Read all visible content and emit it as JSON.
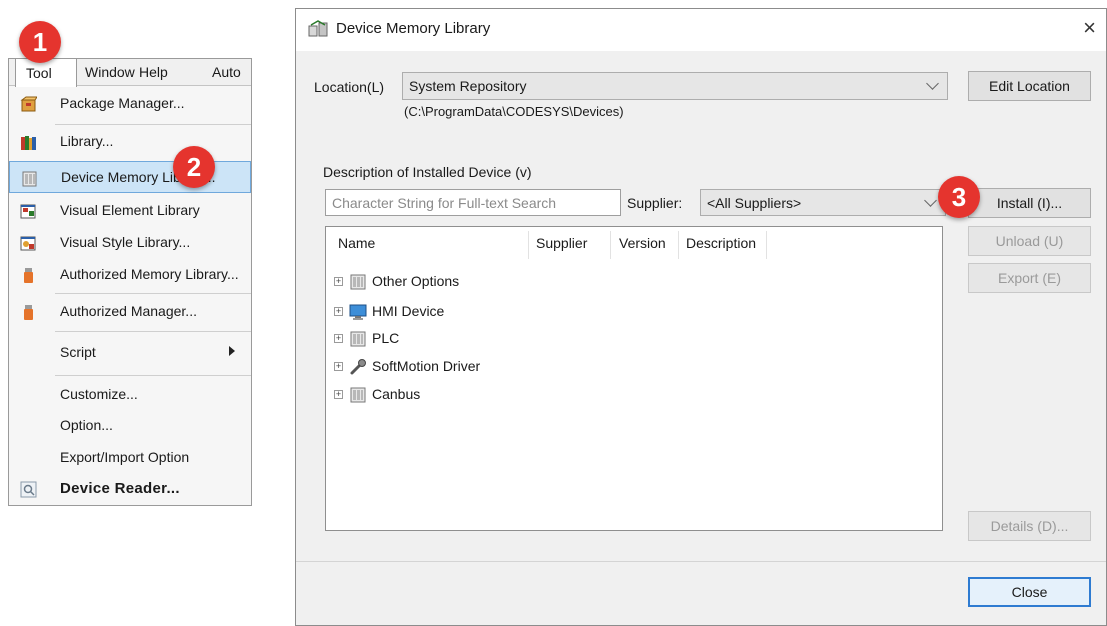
{
  "menu": {
    "menubar": {
      "tool": "Tool",
      "window": "Window",
      "help": "Help",
      "auto": "Auto"
    },
    "items": [
      {
        "label": "Package Manager...",
        "icon": "package-icon"
      },
      {
        "label": "Library...",
        "icon": "library-books-icon"
      },
      {
        "label": "Device Memory Library...",
        "icon": "device-icon"
      },
      {
        "label": "Visual Element Library",
        "icon": "visual-element-icon"
      },
      {
        "label": "Visual Style Library...",
        "icon": "visual-style-icon"
      },
      {
        "label": "Authorized Memory Library...",
        "icon": "usb-key-icon"
      },
      {
        "label": "Authorized Manager...",
        "icon": "usb-key-icon"
      },
      {
        "label": "Script",
        "icon": ""
      },
      {
        "label": "Customize...",
        "icon": ""
      },
      {
        "label": "Option...",
        "icon": ""
      },
      {
        "label": "Export/Import Option",
        "icon": ""
      },
      {
        "label": "Device Reader...",
        "icon": "device-reader-icon"
      }
    ]
  },
  "badges": {
    "one": "1",
    "two": "2",
    "three": "3"
  },
  "dialog": {
    "title": "Device Memory Library",
    "close_glyph": "×",
    "location_label": "Location(L)",
    "location_value": "System Repository",
    "location_path": "(C:\\ProgramData\\CODESYS\\Devices)",
    "edit_location": "Edit Location",
    "description_label": "Description of Installed Device (v)",
    "search_placeholder": "Character String for Full-text Search",
    "supplier_label": "Supplier:",
    "supplier_value": "<All Suppliers>",
    "columns": [
      "Name",
      "Supplier",
      "Version",
      "Description"
    ],
    "tree": [
      {
        "label": "Other Options",
        "icon": "device-icon"
      },
      {
        "label": "HMI Device",
        "icon": "monitor-icon"
      },
      {
        "label": "PLC",
        "icon": "device-icon"
      },
      {
        "label": "SoftMotion Driver",
        "icon": "wrench-icon"
      },
      {
        "label": "Canbus",
        "icon": "device-icon"
      }
    ],
    "buttons": {
      "install": "Install (I)...",
      "unload": "Unload (U)",
      "export": "Export (E)",
      "details": "Details (D)...",
      "close": "Close"
    }
  },
  "colors": {
    "badge": "#e5342e",
    "selection": "#cce4f7",
    "primary_border": "#2e7bd1"
  }
}
